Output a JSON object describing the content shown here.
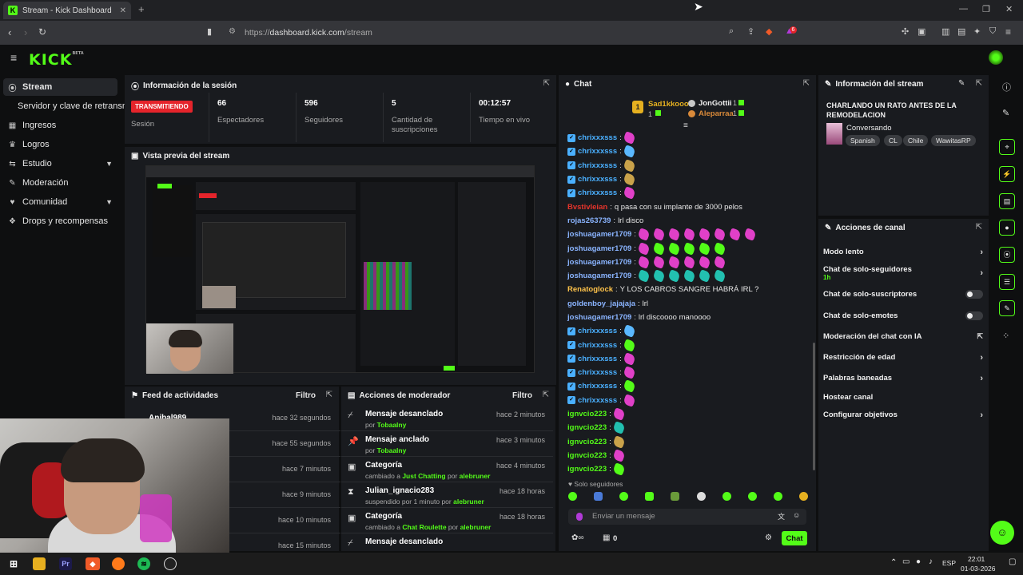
{
  "browser": {
    "tab_title": "Stream - Kick Dashboard",
    "url_prefix": "https://",
    "url_host": "dashboard.kick.com",
    "url_path": "/stream",
    "shield_count": "6"
  },
  "brand": {
    "logo": "KICK",
    "logo_sup": "BETA",
    "accent": "#53fc18"
  },
  "sidebar": {
    "items": [
      {
        "label": "Stream",
        "icon": "broadcast-icon"
      },
      {
        "label": "Servidor y clave de retransmisión"
      },
      {
        "label": "Ingresos",
        "icon": "money-icon"
      },
      {
        "label": "Logros",
        "icon": "trophy-icon"
      },
      {
        "label": "Estudio",
        "icon": "studio-icon"
      },
      {
        "label": "Moderación",
        "icon": "wrench-icon"
      },
      {
        "label": "Comunidad",
        "icon": "community-icon"
      },
      {
        "label": "Drops y recompensas",
        "icon": "gift-icon"
      }
    ]
  },
  "session": {
    "title": "Información de la sesión",
    "status_badge": "TRANSMITIENDO",
    "status_label": "Sesión",
    "viewers": "66",
    "viewers_label": "Espectadores",
    "followers": "596",
    "followers_label": "Seguidores",
    "subs": "5",
    "subs_label": "Cantidad de suscripciones",
    "time": "00:12:57",
    "time_label": "Tiempo en vivo"
  },
  "preview": {
    "title": "Vista previa del stream"
  },
  "feed": {
    "title": "Feed de actividades",
    "filter": "Filtro",
    "rows": [
      {
        "name": "Anibal989",
        "time": "hace 32 segundos"
      },
      {
        "name": "",
        "time": "hace 55 segundos"
      },
      {
        "name": "",
        "time": "hace 7 minutos"
      },
      {
        "name": "",
        "time": "hace 9 minutos"
      },
      {
        "name": "",
        "time": "hace 10 minutos"
      },
      {
        "name": "",
        "time": "hace 15 minutos"
      }
    ]
  },
  "modactions": {
    "title": "Acciones de moderador",
    "filter": "Filtro",
    "rows": [
      {
        "action": "Mensaje desanclado",
        "detail": "por ",
        "who": "Tobaalny",
        "time": "hace 2 minutos"
      },
      {
        "action": "Mensaje anclado",
        "detail": "por ",
        "who": "Tobaalny",
        "time": "hace 3 minutos"
      },
      {
        "action": "Categoría",
        "detail": "cambiado a ",
        "cat": "Just Chatting",
        "mid": " por ",
        "who": "alebruner",
        "time": "hace 4 minutos"
      },
      {
        "action": "Julian_ignacio283",
        "detail": "suspendido por 1 minuto por ",
        "who": "alebruner",
        "time": "hace 18 horas"
      },
      {
        "action": "Categoría",
        "detail": "cambiado a ",
        "cat": "Chat Roulette",
        "mid": " por ",
        "who": "alebruner",
        "time": "hace 18 horas"
      },
      {
        "action": "Mensaje desanclado",
        "detail": "",
        "who": "",
        "time": ""
      }
    ]
  },
  "chat": {
    "title": "Chat",
    "top": [
      {
        "name": "Sad1kkooo",
        "count": "1"
      },
      {
        "name": "JonGottii",
        "count": "1"
      },
      {
        "name": "Aleparraa",
        "count": "1"
      }
    ],
    "first_count": "1",
    "lines": [
      {
        "user": "chrixxxsss",
        "color": "#4ab0ff",
        "verified": true,
        "text": "",
        "emotes": [
          "#e040c8"
        ]
      },
      {
        "user": "chrixxxsss",
        "color": "#4ab0ff",
        "verified": true,
        "text": "",
        "emotes": [
          "#5ab8ff"
        ]
      },
      {
        "user": "chrixxxsss",
        "color": "#4ab0ff",
        "verified": true,
        "text": "",
        "emotes": [
          "#c9a24a"
        ]
      },
      {
        "user": "chrixxxsss",
        "color": "#4ab0ff",
        "verified": true,
        "text": "",
        "emotes": [
          "#c9a24a"
        ]
      },
      {
        "user": "chrixxxsss",
        "color": "#4ab0ff",
        "verified": true,
        "text": "",
        "emotes": [
          "#e040c8"
        ]
      },
      {
        "user": "Bvstivleian",
        "color": "#e5342b",
        "verified": false,
        "text": "q pasa con su implante de 3000 pelos",
        "emotes": []
      },
      {
        "user": "rojas263739",
        "color": "#8ab4ff",
        "verified": false,
        "text": "lrl disco",
        "emotes": []
      },
      {
        "user": "joshuagamer1709",
        "color": "#8ab4ff",
        "verified": false,
        "text": "",
        "emotes": [
          "#e040c8",
          "#e040c8",
          "#e040c8",
          "#e040c8",
          "#e040c8",
          "#e040c8",
          "#e040c8",
          "#e040c8"
        ]
      },
      {
        "user": "joshuagamer1709",
        "color": "#8ab4ff",
        "verified": false,
        "text": "",
        "emotes": [
          "#e040c8",
          "#53fc18",
          "#53fc18",
          "#53fc18",
          "#53fc18",
          "#53fc18"
        ]
      },
      {
        "user": "joshuagamer1709",
        "color": "#8ab4ff",
        "verified": false,
        "text": "",
        "emotes": [
          "#e040c8",
          "#e040c8",
          "#e040c8",
          "#e040c8",
          "#e040c8",
          "#e040c8"
        ]
      },
      {
        "user": "joshuagamer1709",
        "color": "#8ab4ff",
        "verified": false,
        "text": "",
        "emotes": [
          "#22c0b0",
          "#22c0b0",
          "#22c0b0",
          "#22c0b0",
          "#22c0b0",
          "#22c0b0"
        ]
      },
      {
        "user": "Renatoglock",
        "color": "#ffc34a",
        "verified": false,
        "text": "Y LOS CABROS SANGRE HABRÁ IRL ?",
        "emotes": []
      },
      {
        "user": "goldenboy_jajajaja",
        "color": "#8ab4ff",
        "verified": false,
        "text": "lrl",
        "emotes": []
      },
      {
        "user": "joshuagamer1709",
        "color": "#8ab4ff",
        "verified": false,
        "text": "lrl discoooo manoooo",
        "emotes": []
      },
      {
        "user": "chrixxxsss",
        "color": "#4ab0ff",
        "verified": true,
        "text": "",
        "emotes": [
          "#5ab8ff"
        ]
      },
      {
        "user": "chrixxxsss",
        "color": "#4ab0ff",
        "verified": true,
        "text": "",
        "emotes": [
          "#53fc18"
        ]
      },
      {
        "user": "chrixxxsss",
        "color": "#4ab0ff",
        "verified": true,
        "text": "",
        "emotes": [
          "#e040c8"
        ]
      },
      {
        "user": "chrixxxsss",
        "color": "#4ab0ff",
        "verified": true,
        "text": "",
        "emotes": [
          "#e040c8"
        ]
      },
      {
        "user": "chrixxxsss",
        "color": "#4ab0ff",
        "verified": true,
        "text": "",
        "emotes": [
          "#53fc18"
        ]
      },
      {
        "user": "chrixxxsss",
        "color": "#4ab0ff",
        "verified": true,
        "text": "",
        "emotes": [
          "#e040c8"
        ]
      },
      {
        "user": "ignvcio223",
        "color": "#53fc18",
        "verified": false,
        "text": "",
        "emotes": [
          "#e040c8"
        ]
      },
      {
        "user": "ignvcio223",
        "color": "#53fc18",
        "verified": false,
        "text": "",
        "emotes": [
          "#22c0b0"
        ]
      },
      {
        "user": "ignvcio223",
        "color": "#53fc18",
        "verified": false,
        "text": "",
        "emotes": [
          "#c9a24a"
        ]
      },
      {
        "user": "ignvcio223",
        "color": "#53fc18",
        "verified": false,
        "text": "",
        "emotes": [
          "#e040c8"
        ]
      },
      {
        "user": "ignvcio223",
        "color": "#53fc18",
        "verified": false,
        "text": "",
        "emotes": [
          "#53fc18"
        ]
      }
    ],
    "followers_only": "Solo seguidores",
    "input_placeholder": "Enviar un mensaje",
    "viewer_count": "0",
    "send_label": "Chat"
  },
  "streaminfo": {
    "title": "Información del stream",
    "stream_title": "CHARLANDO UN RATO ANTES DE LA REMODELACION",
    "category": "Conversando",
    "tags": [
      "Spanish",
      "CL",
      "Chile",
      "WawitasRP"
    ]
  },
  "channel_actions": {
    "title": "Acciones de canal",
    "items": [
      {
        "label": "Modo lento",
        "type": "chevron"
      },
      {
        "label": "Chat de solo-seguidores",
        "sub": "1h",
        "type": "chevron"
      },
      {
        "label": "Chat de solo-suscriptores",
        "type": "toggle"
      },
      {
        "label": "Chat de solo-emotes",
        "type": "toggle"
      },
      {
        "label": "Moderación del chat con IA",
        "type": "external"
      },
      {
        "label": "Restricción de edad",
        "type": "chevron"
      },
      {
        "label": "Palabras baneadas",
        "type": "chevron"
      },
      {
        "label": "Hostear canal",
        "type": "none"
      },
      {
        "label": "Configurar objetivos",
        "type": "chevron"
      }
    ]
  },
  "taskbar": {
    "time": "22:01",
    "date": "01-03-2026",
    "lang": "ESP"
  }
}
